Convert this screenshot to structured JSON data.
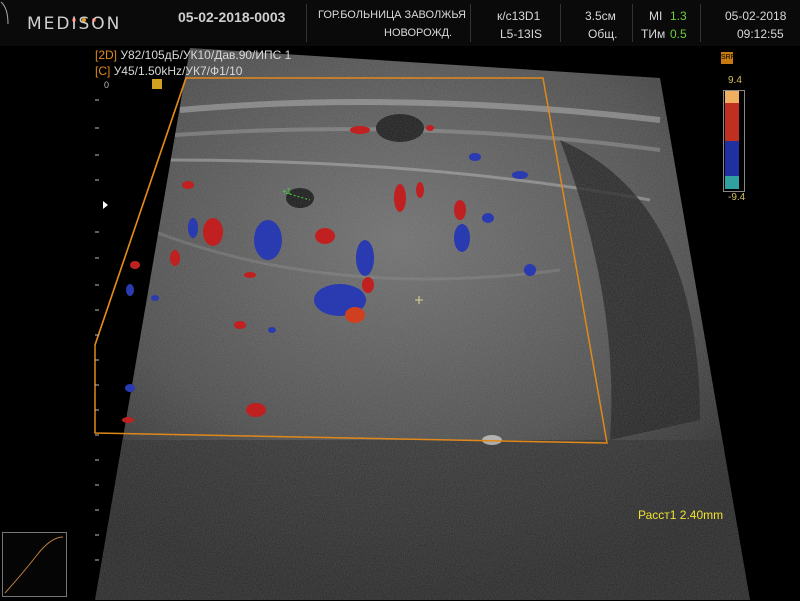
{
  "brand": {
    "name": "MEDISON",
    "dot_colors": [
      "#e04020",
      "#e0a020",
      "#e04020"
    ]
  },
  "header": {
    "exam_id": "05-02-2018-0003",
    "hospital": "ГОР.БОЛЬНИЦА ЗАВОЛЖЬЯ",
    "department": "НОВОРОЖД.",
    "preset": "к/с13D1",
    "probe": "L5-13IS",
    "depth": "3.5см",
    "mode": "Общ.",
    "mi_label": "MI",
    "mi_value": "1.3",
    "tim_label": "ТИм",
    "tim_value": "0.5",
    "date": "05-02-2018",
    "time": "09:12:55"
  },
  "params": {
    "line1_tag": "[2D]",
    "line1_text": "У82/105дБ/УК10/Дав.90/ИПС 1",
    "line2_tag": "[C]",
    "line2_text": "У45/1.50kHz/УК7/Ф1/10"
  },
  "depth_zero": "0",
  "color_scale": {
    "top": "9.4",
    "bottom": "-9.4",
    "srf_label": "SRF"
  },
  "measurement": {
    "label": "Расст1",
    "value": "2.40mm"
  },
  "caliper": {
    "marker": "+1"
  },
  "colors": {
    "roi_border": "#e0891a",
    "measure_text": "#f2e032",
    "param_text": "#e08a1a"
  }
}
